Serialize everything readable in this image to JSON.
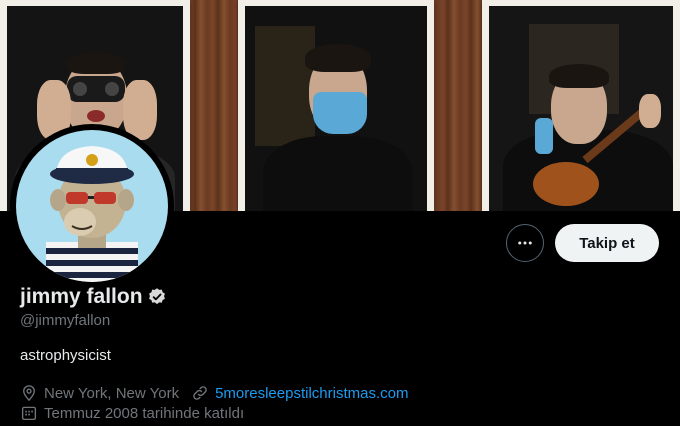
{
  "profile": {
    "display_name": "jimmy fallon",
    "handle": "@jimmyfallon",
    "bio": "astrophysicist",
    "location": "New York, New York",
    "website": "5moresleepstilchristmas.com",
    "joined": "Temmuz 2008 tarihinde katıldı",
    "verified": true
  },
  "actions": {
    "follow_label": "Takip et"
  },
  "icons": {
    "more": "more-horizontal-icon",
    "verified": "verified-badge-icon",
    "location": "location-pin-icon",
    "website": "link-icon",
    "joined": "calendar-icon"
  },
  "colors": {
    "background": "#000000",
    "text": "#e7e9ea",
    "muted": "#71767b",
    "link": "#1d9bf0",
    "follow_button_bg": "#eff3f4",
    "avatar_bg": "#a9dcef"
  }
}
